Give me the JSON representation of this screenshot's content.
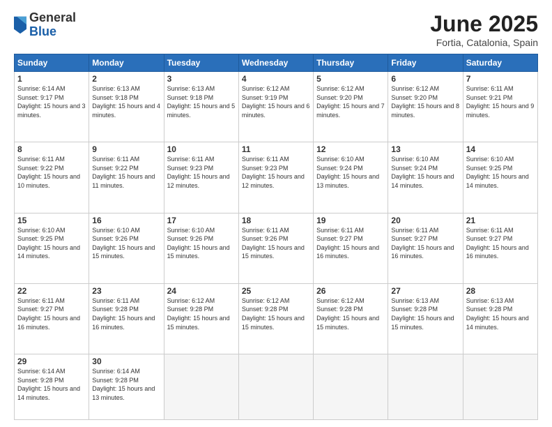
{
  "logo": {
    "general": "General",
    "blue": "Blue"
  },
  "header": {
    "month": "June 2025",
    "location": "Fortia, Catalonia, Spain"
  },
  "weekdays": [
    "Sunday",
    "Monday",
    "Tuesday",
    "Wednesday",
    "Thursday",
    "Friday",
    "Saturday"
  ],
  "days": [
    {
      "num": "1",
      "sunrise": "6:14 AM",
      "sunset": "9:17 PM",
      "daylight": "15 hours and 3 minutes."
    },
    {
      "num": "2",
      "sunrise": "6:13 AM",
      "sunset": "9:18 PM",
      "daylight": "15 hours and 4 minutes."
    },
    {
      "num": "3",
      "sunrise": "6:13 AM",
      "sunset": "9:18 PM",
      "daylight": "15 hours and 5 minutes."
    },
    {
      "num": "4",
      "sunrise": "6:12 AM",
      "sunset": "9:19 PM",
      "daylight": "15 hours and 6 minutes."
    },
    {
      "num": "5",
      "sunrise": "6:12 AM",
      "sunset": "9:20 PM",
      "daylight": "15 hours and 7 minutes."
    },
    {
      "num": "6",
      "sunrise": "6:12 AM",
      "sunset": "9:20 PM",
      "daylight": "15 hours and 8 minutes."
    },
    {
      "num": "7",
      "sunrise": "6:11 AM",
      "sunset": "9:21 PM",
      "daylight": "15 hours and 9 minutes."
    },
    {
      "num": "8",
      "sunrise": "6:11 AM",
      "sunset": "9:22 PM",
      "daylight": "15 hours and 10 minutes."
    },
    {
      "num": "9",
      "sunrise": "6:11 AM",
      "sunset": "9:22 PM",
      "daylight": "15 hours and 11 minutes."
    },
    {
      "num": "10",
      "sunrise": "6:11 AM",
      "sunset": "9:23 PM",
      "daylight": "15 hours and 12 minutes."
    },
    {
      "num": "11",
      "sunrise": "6:11 AM",
      "sunset": "9:23 PM",
      "daylight": "15 hours and 12 minutes."
    },
    {
      "num": "12",
      "sunrise": "6:10 AM",
      "sunset": "9:24 PM",
      "daylight": "15 hours and 13 minutes."
    },
    {
      "num": "13",
      "sunrise": "6:10 AM",
      "sunset": "9:24 PM",
      "daylight": "15 hours and 14 minutes."
    },
    {
      "num": "14",
      "sunrise": "6:10 AM",
      "sunset": "9:25 PM",
      "daylight": "15 hours and 14 minutes."
    },
    {
      "num": "15",
      "sunrise": "6:10 AM",
      "sunset": "9:25 PM",
      "daylight": "15 hours and 14 minutes."
    },
    {
      "num": "16",
      "sunrise": "6:10 AM",
      "sunset": "9:26 PM",
      "daylight": "15 hours and 15 minutes."
    },
    {
      "num": "17",
      "sunrise": "6:10 AM",
      "sunset": "9:26 PM",
      "daylight": "15 hours and 15 minutes."
    },
    {
      "num": "18",
      "sunrise": "6:11 AM",
      "sunset": "9:26 PM",
      "daylight": "15 hours and 15 minutes."
    },
    {
      "num": "19",
      "sunrise": "6:11 AM",
      "sunset": "9:27 PM",
      "daylight": "15 hours and 16 minutes."
    },
    {
      "num": "20",
      "sunrise": "6:11 AM",
      "sunset": "9:27 PM",
      "daylight": "15 hours and 16 minutes."
    },
    {
      "num": "21",
      "sunrise": "6:11 AM",
      "sunset": "9:27 PM",
      "daylight": "15 hours and 16 minutes."
    },
    {
      "num": "22",
      "sunrise": "6:11 AM",
      "sunset": "9:27 PM",
      "daylight": "15 hours and 16 minutes."
    },
    {
      "num": "23",
      "sunrise": "6:11 AM",
      "sunset": "9:28 PM",
      "daylight": "15 hours and 16 minutes."
    },
    {
      "num": "24",
      "sunrise": "6:12 AM",
      "sunset": "9:28 PM",
      "daylight": "15 hours and 15 minutes."
    },
    {
      "num": "25",
      "sunrise": "6:12 AM",
      "sunset": "9:28 PM",
      "daylight": "15 hours and 15 minutes."
    },
    {
      "num": "26",
      "sunrise": "6:12 AM",
      "sunset": "9:28 PM",
      "daylight": "15 hours and 15 minutes."
    },
    {
      "num": "27",
      "sunrise": "6:13 AM",
      "sunset": "9:28 PM",
      "daylight": "15 hours and 15 minutes."
    },
    {
      "num": "28",
      "sunrise": "6:13 AM",
      "sunset": "9:28 PM",
      "daylight": "15 hours and 14 minutes."
    },
    {
      "num": "29",
      "sunrise": "6:14 AM",
      "sunset": "9:28 PM",
      "daylight": "15 hours and 14 minutes."
    },
    {
      "num": "30",
      "sunrise": "6:14 AM",
      "sunset": "9:28 PM",
      "daylight": "15 hours and 13 minutes."
    }
  ]
}
